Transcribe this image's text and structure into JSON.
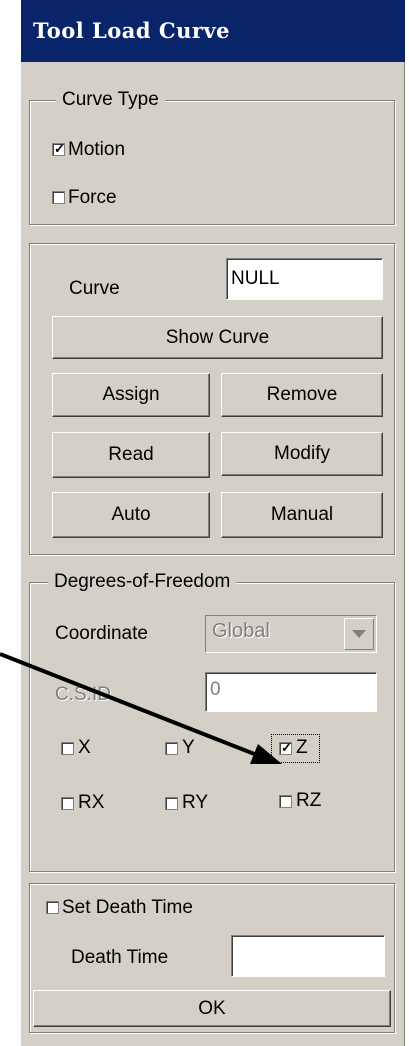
{
  "title": "Tool Load Curve",
  "curve_type": {
    "legend": "Curve Type",
    "motion_label": "Motion",
    "motion_checked": true,
    "force_label": "Force",
    "force_checked": false
  },
  "curve": {
    "label": "Curve",
    "value": "NULL",
    "show_curve": "Show Curve",
    "assign": "Assign",
    "remove": "Remove",
    "read": "Read",
    "modify": "Modify",
    "auto": "Auto",
    "manual": "Manual"
  },
  "dof": {
    "legend": "Degrees-of-Freedom",
    "coordinate_label": "Coordinate",
    "coordinate_value": "Global",
    "csid_label": "C.S.ID",
    "csid_value": "0",
    "x": "X",
    "y": "Y",
    "z": "Z",
    "rx": "RX",
    "ry": "RY",
    "rz": "RZ",
    "z_checked": true
  },
  "death": {
    "set_label": "Set Death Time",
    "time_label": "Death Time",
    "time_value": "",
    "ok": "OK"
  }
}
